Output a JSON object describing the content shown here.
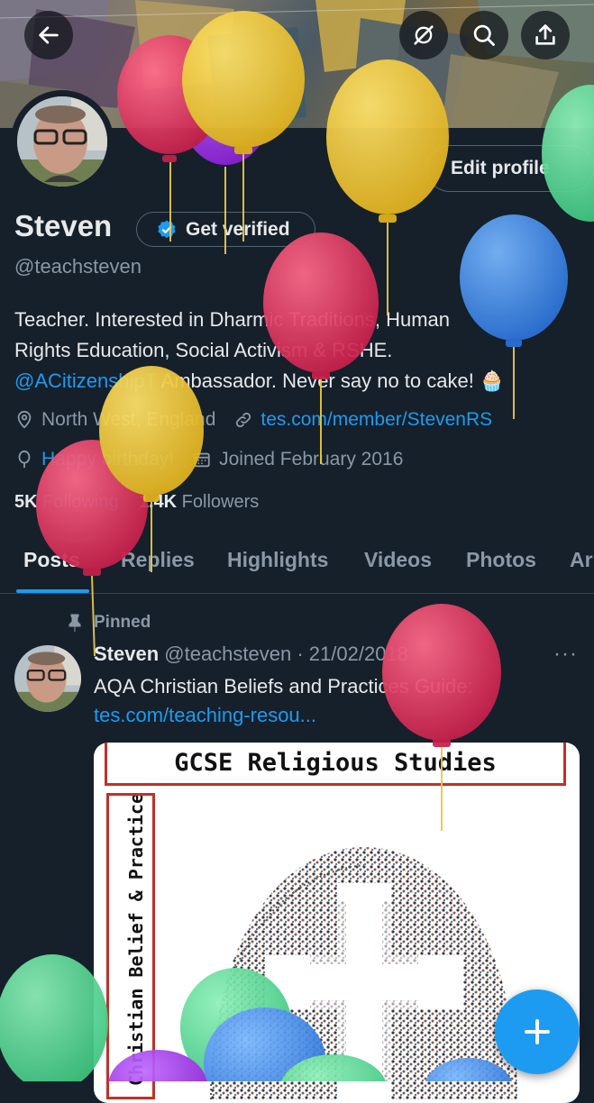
{
  "header": {
    "back_icon": "arrow-left-icon",
    "icons": [
      "no-signal-icon",
      "search-icon",
      "share-icon"
    ]
  },
  "profile": {
    "edit_label": "Edit profile",
    "name": "Steven",
    "verify_label": "Get verified",
    "handle": "@teachsteven",
    "bio_line1": "Teacher. Interested in Dharmic Traditions, Human",
    "bio_line2": "Rights Education, Social Activism & RSHE.",
    "bio_mention": "@ACitizenshipT",
    "bio_line3_rest": " Ambassador. Never say no to cake! 🧁",
    "location": "North West, England",
    "website": "tes.com/member/StevenRS",
    "birthday": "Happy birthday!",
    "joined": "Joined February 2016",
    "following_count": "5K",
    "following_label": "Following",
    "followers_count": "1.4K",
    "followers_label": "Followers"
  },
  "tabs": [
    "Posts",
    "Replies",
    "Highlights",
    "Videos",
    "Photos",
    "Ar"
  ],
  "post": {
    "pinned_label": "Pinned",
    "author": "Steven",
    "meta": " @teachsteven · 21/02/2018",
    "more": "···",
    "text": "AQA Christian Beliefs and Practices Guide:",
    "link": "tes.com/teaching-resou...",
    "media_title": "GCSE Religious Studies",
    "media_side": "Christian Belief & Practice"
  },
  "colors": {
    "background": "#15202b",
    "accent": "#1d9bf0",
    "muted": "#8b98a5",
    "border": "#38444d"
  },
  "fab_icon": "plus-icon"
}
